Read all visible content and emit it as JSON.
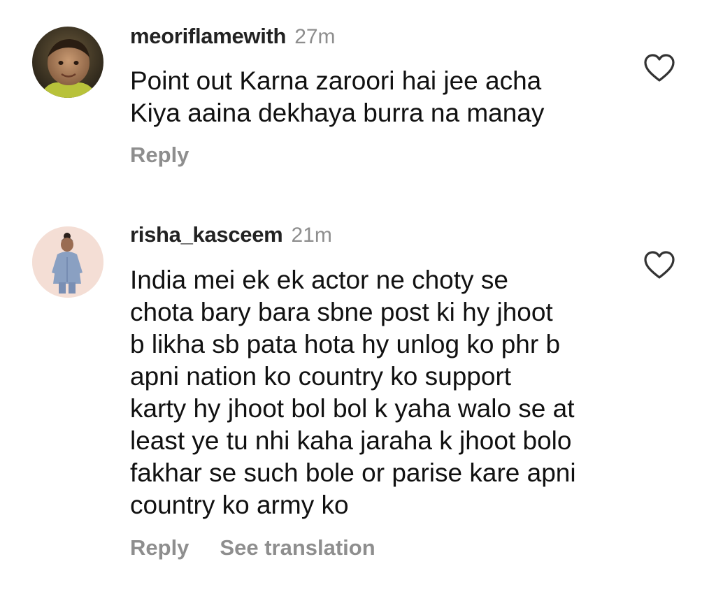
{
  "comments": [
    {
      "username": "meoriflamewith",
      "time": "27m",
      "lines": [
        "Point out Karna zaroori hai jee acha",
        "Kiya aaina dekhaya burra na manay"
      ],
      "actions": [
        "Reply"
      ],
      "like_icon": "heart-outline-icon"
    },
    {
      "username": "risha_kasceem",
      "time": "21m",
      "lines": [
        "India mei ek ek actor ne choty se",
        "chota bary bara sbne post ki hy jhoot",
        "b likha sb pata hota hy unlog ko phr b",
        "apni nation ko country ko support",
        "karty hy jhoot bol bol k yaha walo se at",
        "least ye tu nhi kaha jaraha k jhoot bolo",
        "fakhar se such bole or parise kare apni",
        "country ko army ko"
      ],
      "actions": [
        "Reply",
        "See translation"
      ],
      "like_icon": "heart-outline-icon"
    }
  ],
  "colors": {
    "text": "#111111",
    "username": "#222222",
    "muted": "#8e8e8e",
    "background": "#ffffff"
  }
}
